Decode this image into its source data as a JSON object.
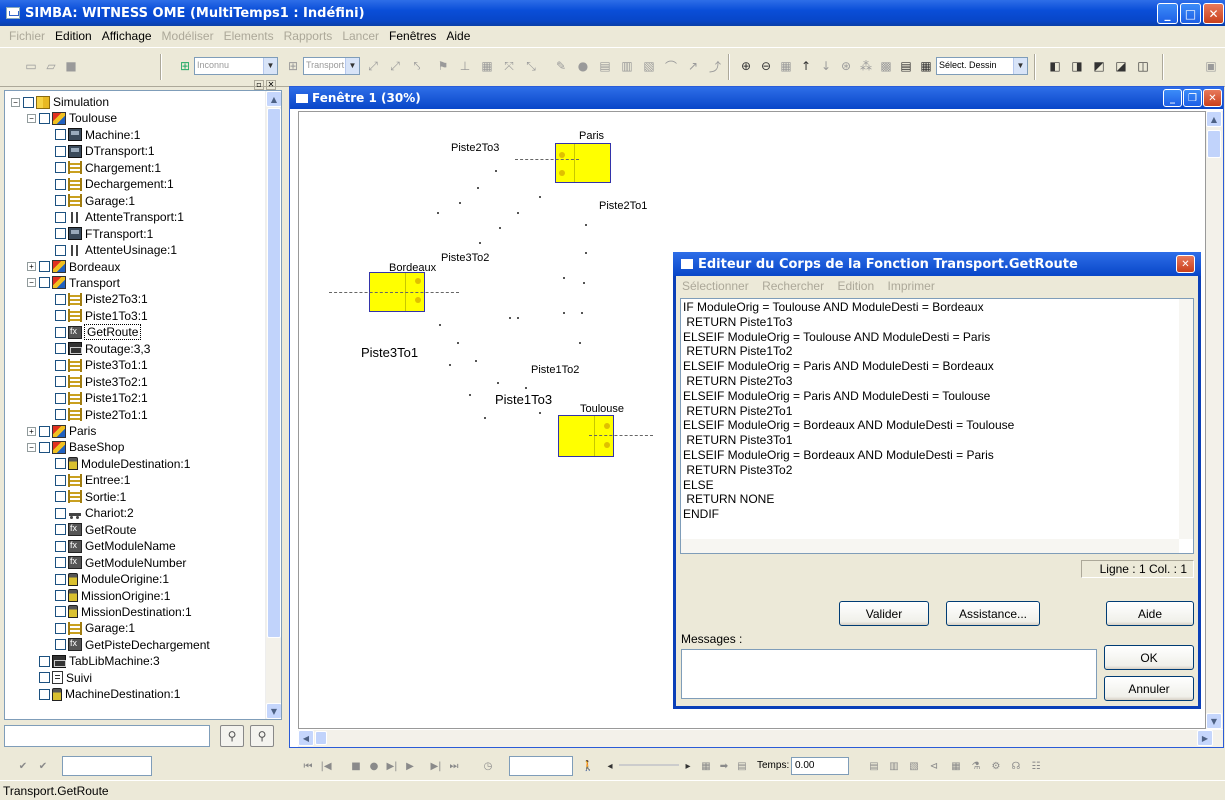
{
  "window": {
    "title": "SIMBA: WITNESS OME (MultiTemps1 : Indéfini)"
  },
  "menu": [
    {
      "label": "Fichier",
      "enabled": false
    },
    {
      "label": "Edition",
      "enabled": true
    },
    {
      "label": "Affichage",
      "enabled": true
    },
    {
      "label": "Modéliser",
      "enabled": false
    },
    {
      "label": "Elements",
      "enabled": false
    },
    {
      "label": "Rapports",
      "enabled": false
    },
    {
      "label": "Lancer",
      "enabled": false
    },
    {
      "label": "Fenêtres",
      "enabled": true
    },
    {
      "label": "Aide",
      "enabled": true
    }
  ],
  "toolbar": {
    "type_combo": "Inconnu",
    "element_combo": "Transport.GetR",
    "draw_combo": "Sélect. Dessin"
  },
  "tree": {
    "items": [
      {
        "label": "Simulation",
        "icon": "sim",
        "level": 0,
        "pm": "-"
      },
      {
        "label": "Toulouse",
        "icon": "mod",
        "level": 1,
        "pm": "-"
      },
      {
        "label": "Machine:1",
        "icon": "mach",
        "level": 2
      },
      {
        "label": "DTransport:1",
        "icon": "mach",
        "level": 2
      },
      {
        "label": "Chargement:1",
        "icon": "buf",
        "level": 2
      },
      {
        "label": "Dechargement:1",
        "icon": "buf",
        "level": 2
      },
      {
        "label": "Garage:1",
        "icon": "buf",
        "level": 2
      },
      {
        "label": "AttenteTransport:1",
        "icon": "att",
        "level": 2
      },
      {
        "label": "FTransport:1",
        "icon": "mach",
        "level": 2
      },
      {
        "label": "AttenteUsinage:1",
        "icon": "att",
        "level": 2
      },
      {
        "label": "Bordeaux",
        "icon": "mod",
        "level": 1,
        "pm": "+"
      },
      {
        "label": "Transport",
        "icon": "mod",
        "level": 1,
        "pm": "-"
      },
      {
        "label": "Piste2To3:1",
        "icon": "buf",
        "level": 2
      },
      {
        "label": "Piste1To3:1",
        "icon": "buf",
        "level": 2
      },
      {
        "label": "GetRoute",
        "icon": "fn",
        "level": 2,
        "selected": true
      },
      {
        "label": "Routage:3,3",
        "icon": "tab",
        "level": 2
      },
      {
        "label": "Piste3To1:1",
        "icon": "buf",
        "level": 2
      },
      {
        "label": "Piste3To2:1",
        "icon": "buf",
        "level": 2
      },
      {
        "label": "Piste1To2:1",
        "icon": "buf",
        "level": 2
      },
      {
        "label": "Piste2To1:1",
        "icon": "buf",
        "level": 2
      },
      {
        "label": "Paris",
        "icon": "mod",
        "level": 1,
        "pm": "+"
      },
      {
        "label": "BaseShop",
        "icon": "mod",
        "level": 1,
        "pm": "-"
      },
      {
        "label": "ModuleDestination:1",
        "icon": "var",
        "level": 2
      },
      {
        "label": "Entree:1",
        "icon": "buf",
        "level": 2
      },
      {
        "label": "Sortie:1",
        "icon": "buf",
        "level": 2
      },
      {
        "label": "Chariot:2",
        "icon": "cart",
        "level": 2
      },
      {
        "label": "GetRoute",
        "icon": "fn",
        "level": 2
      },
      {
        "label": "GetModuleName",
        "icon": "fn",
        "level": 2
      },
      {
        "label": "GetModuleNumber",
        "icon": "fn",
        "level": 2
      },
      {
        "label": "ModuleOrigine:1",
        "icon": "var",
        "level": 2
      },
      {
        "label": "MissionOrigine:1",
        "icon": "var",
        "level": 2
      },
      {
        "label": "MissionDestination:1",
        "icon": "var",
        "level": 2
      },
      {
        "label": "Garage:1",
        "icon": "buf",
        "level": 2
      },
      {
        "label": "GetPisteDechargement",
        "icon": "fn",
        "level": 2
      },
      {
        "label": "TabLibMachine:3",
        "icon": "tab",
        "level": 1
      },
      {
        "label": "Suivi",
        "icon": "doc",
        "level": 1
      },
      {
        "label": "MachineDestination:1",
        "icon": "var",
        "level": 1
      }
    ]
  },
  "canvas_window": {
    "title": "Fenêtre 1 (30%)"
  },
  "canvas": {
    "modules": [
      {
        "name": "Paris",
        "label": "Paris"
      },
      {
        "name": "Bordeaux",
        "label": "Bordeaux"
      },
      {
        "name": "Toulouse",
        "label": "Toulouse"
      }
    ],
    "routes": [
      {
        "name": "Piste2To3",
        "label": "Piste2To3"
      },
      {
        "name": "Piste2To1",
        "label": "Piste2To1"
      },
      {
        "name": "Piste3To2",
        "label": "Piste3To2"
      },
      {
        "name": "Piste3To1",
        "label": "Piste3To1"
      },
      {
        "name": "Piste1To2",
        "label": "Piste1To2"
      },
      {
        "name": "Piste1To3",
        "label": "Piste1To3"
      }
    ]
  },
  "editor": {
    "title": "Editeur du Corps de la Fonction Transport.GetRoute",
    "menu": [
      "Sélectionner",
      "Rechercher",
      "Edition",
      "Imprimer"
    ],
    "code": "IF ModuleOrig = Toulouse AND ModuleDesti = Bordeaux\n RETURN Piste1To3\nELSEIF ModuleOrig = Toulouse AND ModuleDesti = Paris\n RETURN Piste1To2\nELSEIF ModuleOrig = Paris AND ModuleDesti = Bordeaux\n RETURN Piste2To3\nELSEIF ModuleOrig = Paris AND ModuleDesti = Toulouse\n RETURN Piste2To1\nELSEIF ModuleOrig = Bordeaux AND ModuleDesti = Toulouse\n RETURN Piste3To1\nELSEIF ModuleOrig = Bordeaux AND ModuleDesti = Paris\n RETURN Piste3To2\nELSE\n RETURN NONE\nENDIF",
    "position": "Ligne : 1 Col. : 1",
    "buttons": {
      "valider": "Valider",
      "assistance": "Assistance...",
      "aide": "Aide",
      "ok": "OK",
      "annuler": "Annuler"
    },
    "messages_label": "Messages :"
  },
  "bottom_toolbar": {
    "time_label": "Temps:",
    "time_value": "0.00"
  },
  "status_bar": {
    "text": "Transport.GetRoute"
  }
}
